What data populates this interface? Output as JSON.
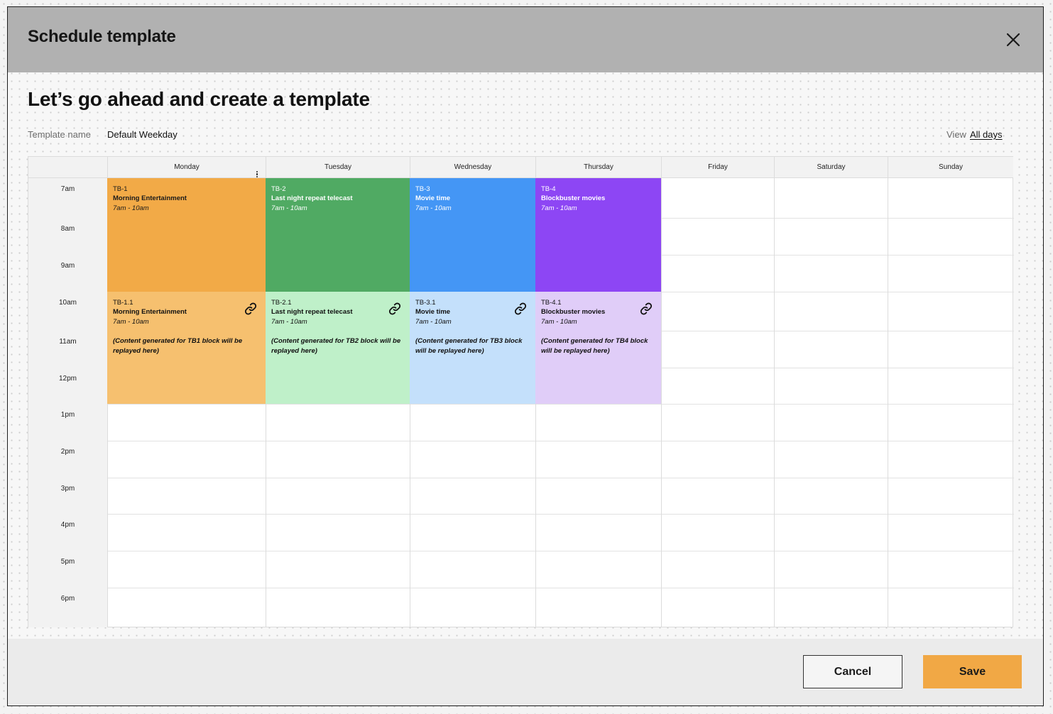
{
  "modal": {
    "title": "Schedule template",
    "heading": "Let’s go ahead and create a template"
  },
  "template": {
    "name_label": "Template name",
    "name_value": "Default Weekday",
    "view_label": "View",
    "view_value": "All days"
  },
  "days": [
    "Monday",
    "Tuesday",
    "Wednesday",
    "Thursday",
    "Friday",
    "Saturday",
    "Sunday"
  ],
  "hours": [
    "7am",
    "8am",
    "9am",
    "10am",
    "11am",
    "12pm",
    "1pm",
    "2pm",
    "3pm",
    "4pm",
    "5pm",
    "6pm"
  ],
  "blocks": [
    {
      "code": "TB-1",
      "title": "Morning Entertainment",
      "time": "7am - 10am",
      "color": "#f2aa47",
      "text_color": "#1a1a1a"
    },
    {
      "code": "TB-2",
      "title": "Last night repeat telecast",
      "time": "7am - 10am",
      "color": "#50aa63",
      "text_color": "#ffffff"
    },
    {
      "code": "TB-3",
      "title": "Movie time",
      "time": "7am - 10am",
      "color": "#4496f5",
      "text_color": "#ffffff"
    },
    {
      "code": "TB-4",
      "title": "Blockbuster movies",
      "time": "7am - 10am",
      "color": "#8d46f4",
      "text_color": "#ffffff"
    }
  ],
  "replay_blocks": [
    {
      "code": "TB-1.1",
      "title": "Morning Entertainment",
      "time": "7am - 10am",
      "note": "(Content generated for TB1 block will be replayed here)",
      "color": "#f6c06f",
      "icon": "link-icon"
    },
    {
      "code": "TB-2.1",
      "title": "Last night repeat telecast",
      "time": "7am - 10am",
      "note": "(Content generated for TB2 block will be replayed here)",
      "color": "#bff0c9",
      "icon": "link-icon"
    },
    {
      "code": "TB-3.1",
      "title": "Movie time",
      "time": "7am - 10am",
      "note": "(Content generated for TB3 block will be replayed here)",
      "color": "#c4e0fb",
      "icon": "link-icon"
    },
    {
      "code": "TB-4.1",
      "title": "Blockbuster movies",
      "time": "7am - 10am",
      "note": "(Content generated for TB4 block will be replayed here)",
      "color": "#e0cdf8",
      "icon": "link-icon"
    }
  ],
  "footer": {
    "cancel_label": "Cancel",
    "save_label": "Save"
  },
  "colors": {
    "header_bg": "#b1b1b1",
    "accent": "#f1a845"
  }
}
